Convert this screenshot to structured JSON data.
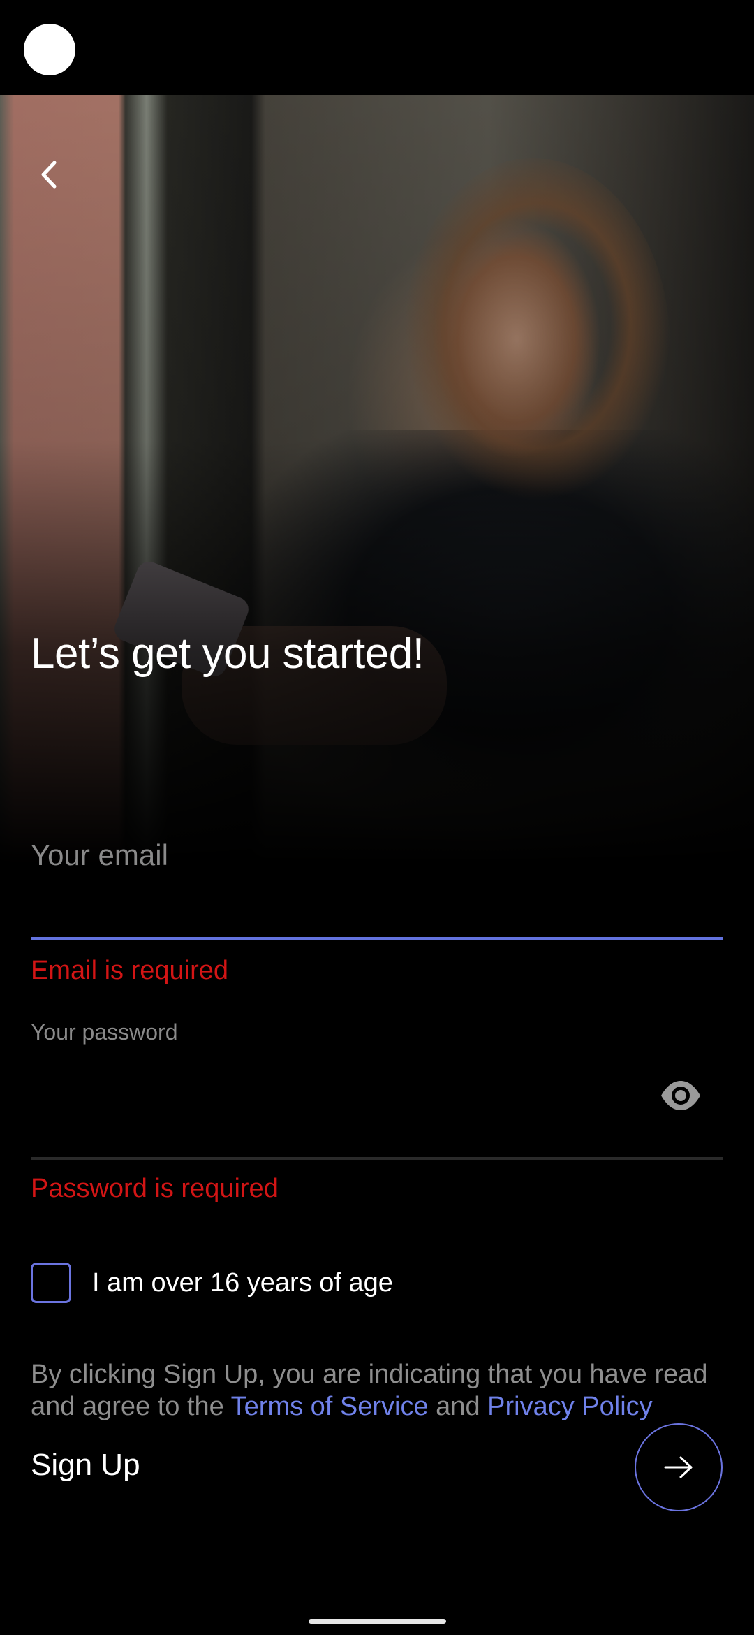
{
  "header": {
    "title": "Let’s get you started!"
  },
  "form": {
    "email": {
      "placeholder": "Your email",
      "value": "",
      "error": "Email is required"
    },
    "password": {
      "label": "Your password",
      "value": "",
      "error": "Password is required"
    },
    "age_checkbox": {
      "label": "I am over 16 years of age",
      "checked": false
    }
  },
  "legal": {
    "prefix": "By clicking Sign Up, you are indicating that you have read and agree to the ",
    "terms_link": "Terms of Service",
    "connector": " and ",
    "privacy_link": "Privacy Policy"
  },
  "footer": {
    "signup_label": "Sign Up"
  },
  "colors": {
    "accent": "#6373df",
    "error": "#d31515",
    "link": "#7082ea"
  },
  "icons": {
    "back": "chevron-left-icon",
    "eye": "eye-icon",
    "submit": "arrow-right-icon"
  }
}
